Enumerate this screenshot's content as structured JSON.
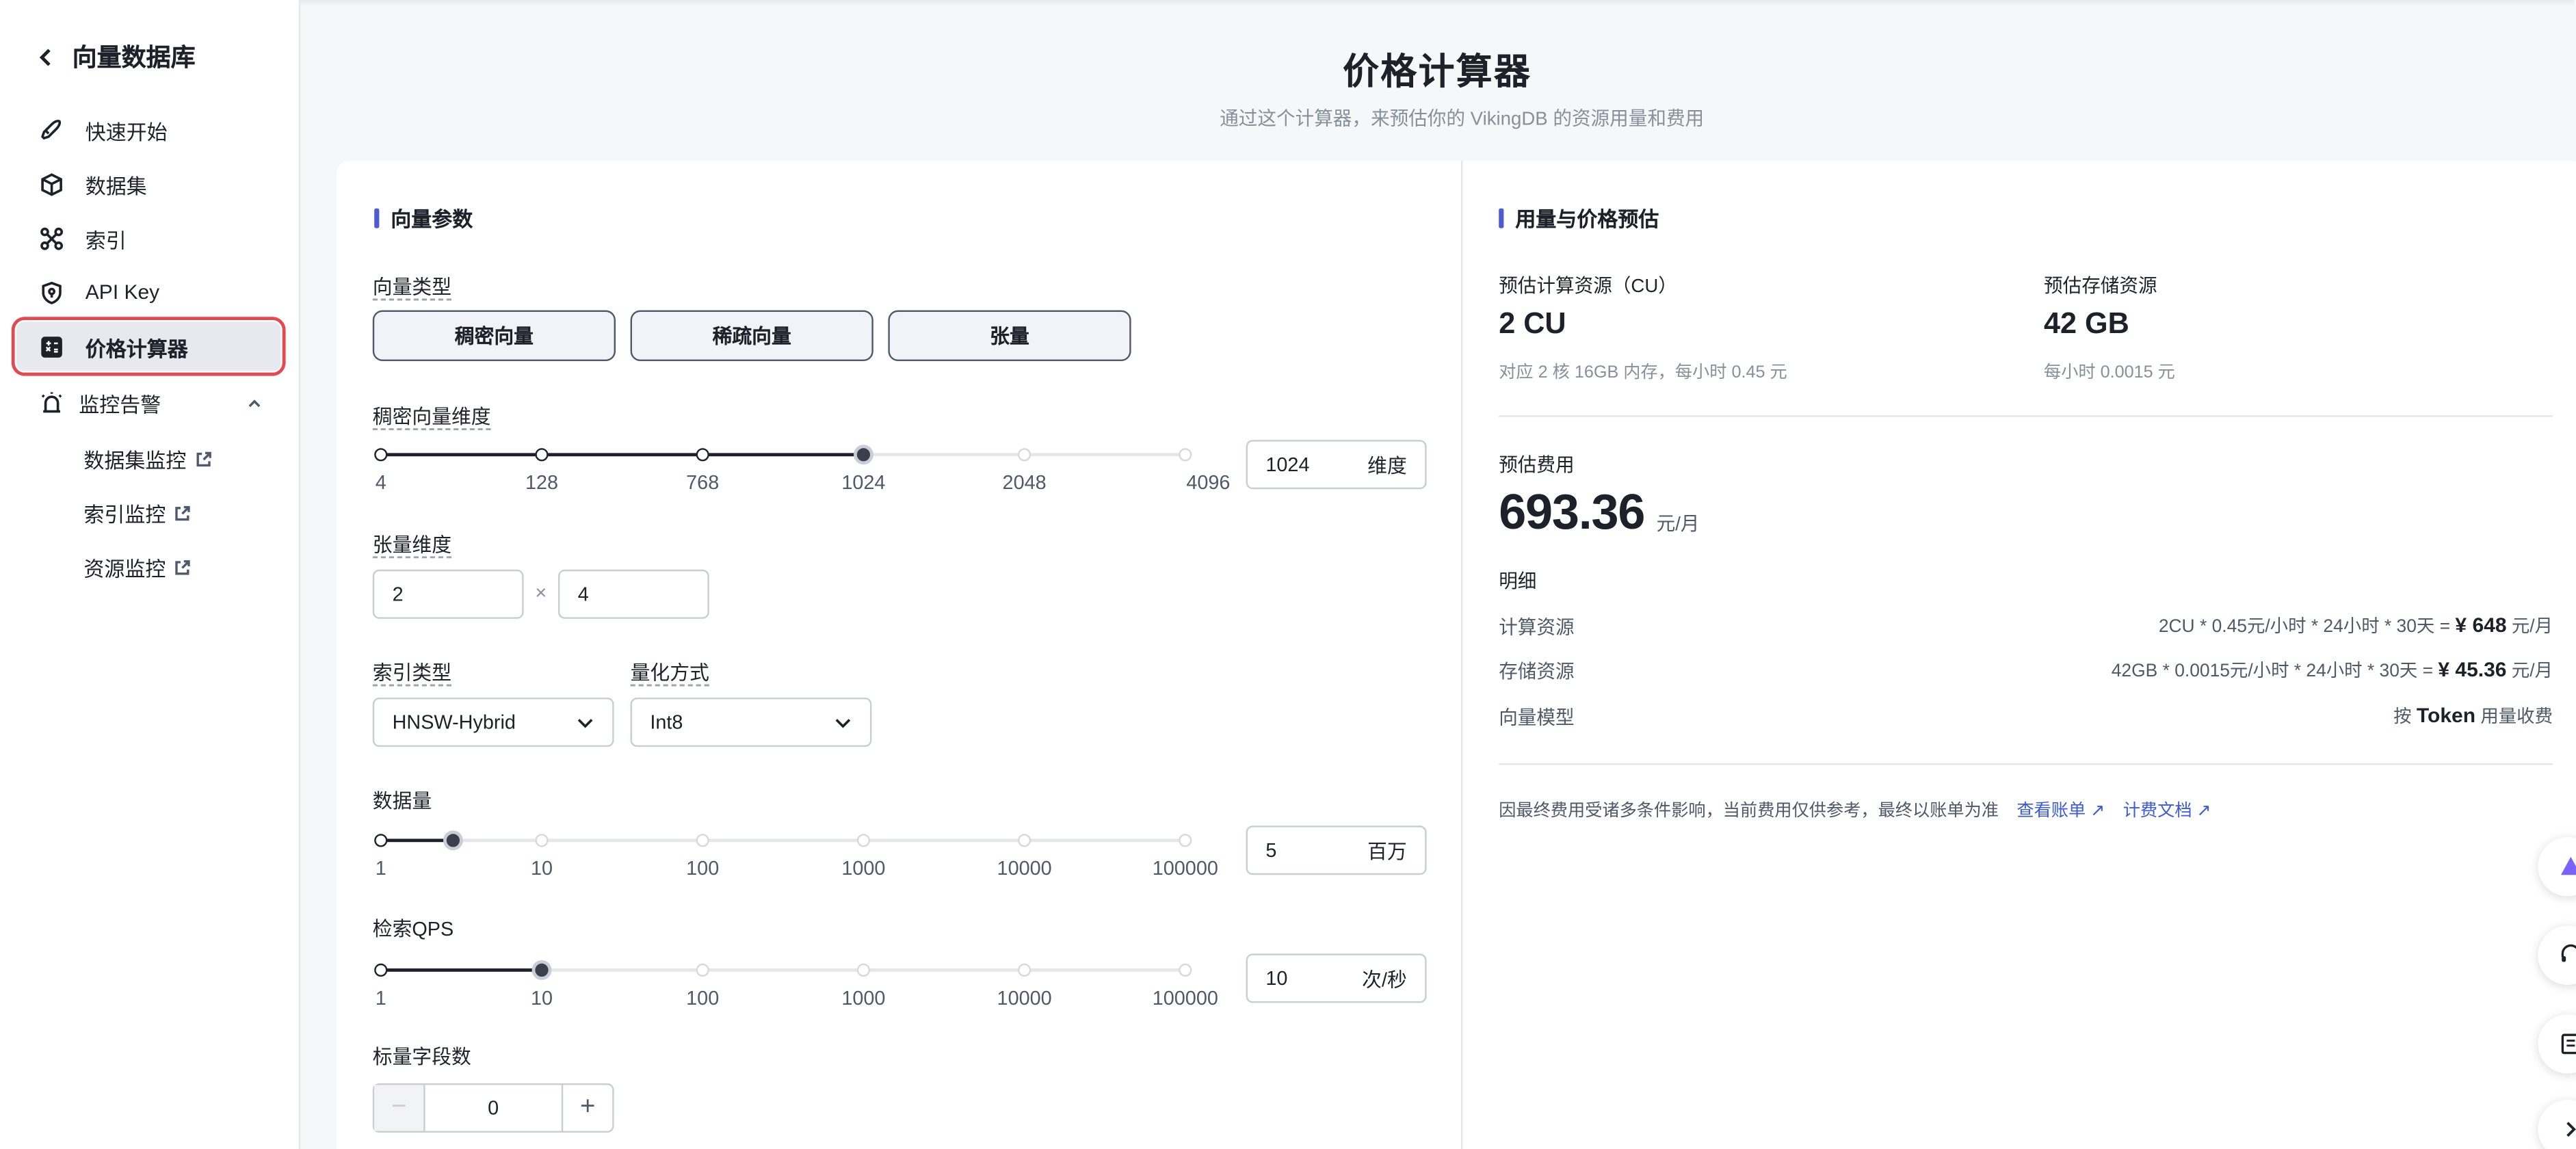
{
  "sidebar": {
    "title": "向量数据库",
    "items": [
      {
        "label": "快速开始"
      },
      {
        "label": "数据集"
      },
      {
        "label": "索引"
      },
      {
        "label": "API Key"
      },
      {
        "label": "价格计算器"
      },
      {
        "label": "监控告警"
      }
    ],
    "subitems": [
      {
        "label": "数据集监控"
      },
      {
        "label": "索引监控"
      },
      {
        "label": "资源监控"
      }
    ]
  },
  "header": {
    "title": "价格计算器",
    "subtitle": "通过这个计算器，来预估你的 VikingDB 的资源用量和费用"
  },
  "params": {
    "section_title": "向量参数",
    "vector_type_label": "向量类型",
    "vector_types": [
      "稠密向量",
      "稀疏向量",
      "张量"
    ],
    "dense_dim_label": "稠密向量维度",
    "dense_dim_ticks": [
      "4",
      "128",
      "768",
      "1024",
      "2048",
      "4096"
    ],
    "dense_dim_value": "1024",
    "dense_dim_unit": "维度",
    "tensor_dim_label": "张量维度",
    "tensor_dim_a": "2",
    "tensor_dim_sep": "×",
    "tensor_dim_b": "4",
    "index_type_label": "索引类型",
    "index_type_value": "HNSW-Hybrid",
    "quant_label": "量化方式",
    "quant_value": "Int8",
    "data_label": "数据量",
    "data_ticks": [
      "1",
      "10",
      "100",
      "1000",
      "10000",
      "100000"
    ],
    "data_value": "5",
    "data_unit": "百万",
    "qps_label": "检索QPS",
    "qps_ticks": [
      "1",
      "10",
      "100",
      "1000",
      "10000",
      "100000"
    ],
    "qps_value": "10",
    "qps_unit": "次/秒",
    "scalar_label": "标量字段数",
    "scalar_value": "0",
    "minus": "−",
    "plus": "+"
  },
  "estimate": {
    "section_title": "用量与价格预估",
    "cu_label": "预估计算资源（CU）",
    "cu_value": "2 CU",
    "cu_note": "对应 2 核 16GB 内存，每小时 0.45 元",
    "storage_label": "预估存储资源",
    "storage_value": "42 GB",
    "storage_note": "每小时 0.0015 元",
    "cost_label": "预估费用",
    "cost_value": "693.36",
    "cost_unit": "元/月",
    "detail_label": "明细",
    "rows": [
      {
        "name": "计算资源",
        "formula": "2CU * 0.45元/小时 * 24小时 * 30天 = ",
        "amount": "¥ 648",
        "unit": " 元/月"
      },
      {
        "name": "存储资源",
        "formula": "42GB * 0.0015元/小时 * 24小时 * 30天 = ",
        "amount": "¥ 45.36",
        "unit": " 元/月"
      },
      {
        "name": "向量模型",
        "formula": "按 ",
        "amount": "Token",
        "unit": " 用量收费"
      }
    ],
    "footnote": "因最终费用受诸多条件影响，当前费用仅供参考，最终以账单为准",
    "link_bill": "查看账单 ↗",
    "link_docs": "计费文档 ↗"
  },
  "slider_state": {
    "dense_dim_selected_index": 3,
    "data_position": 0.45,
    "qps_selected_index": 1
  },
  "colors": {
    "accent": "#4f5bd5",
    "highlight": "#e5484d",
    "link": "#3b5bdb"
  }
}
